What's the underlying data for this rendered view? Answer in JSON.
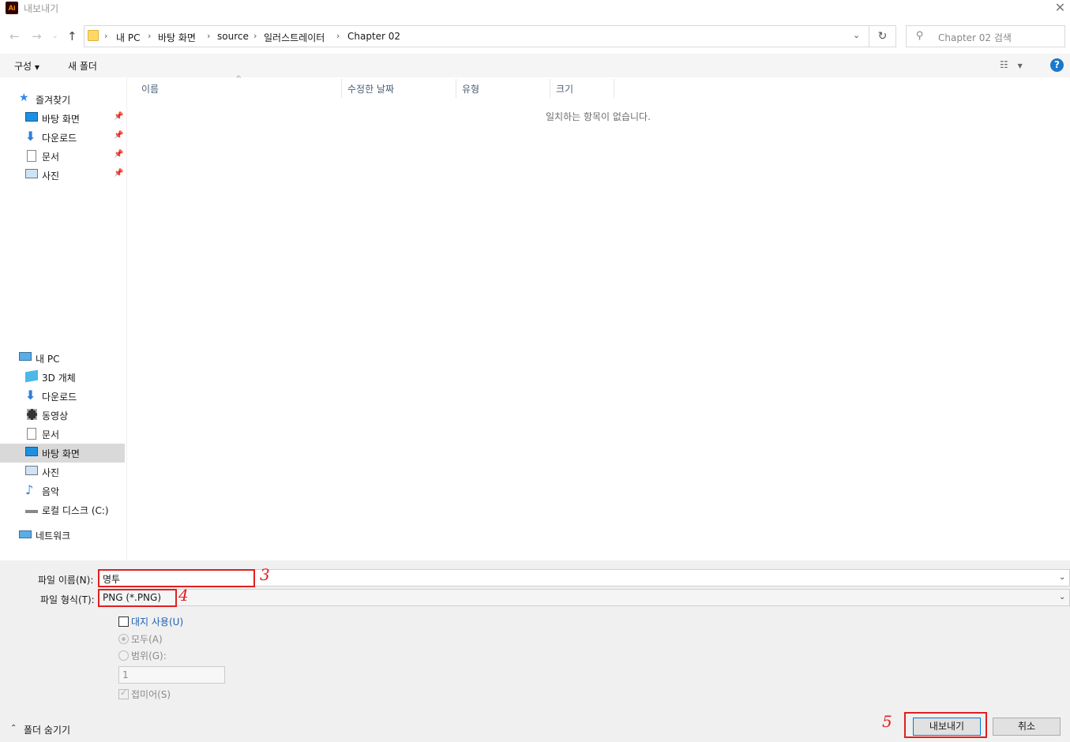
{
  "window": {
    "title": "내보내기",
    "app_icon": "Ai"
  },
  "nav": {
    "breadcrumb": [
      "내 PC",
      "바탕 화면",
      "source",
      "일러스트레이터",
      "Chapter 02"
    ],
    "search_placeholder": "Chapter 02 검색"
  },
  "toolbar": {
    "organize": "구성",
    "new_folder": "새 폴더"
  },
  "sidebar": {
    "favorites": {
      "label": "즐겨찾기",
      "items": [
        "바탕 화면",
        "다운로드",
        "문서",
        "사진"
      ]
    },
    "pc": {
      "label": "내 PC",
      "items": [
        "3D 개체",
        "다운로드",
        "동영상",
        "문서",
        "바탕 화면",
        "사진",
        "음악",
        "로컬 디스크 (C:)"
      ],
      "selected": "바탕 화면"
    },
    "network": {
      "label": "네트워크"
    }
  },
  "columns": [
    "이름",
    "수정한 날짜",
    "유형",
    "크기"
  ],
  "empty_message": "일치하는 항목이 없습니다.",
  "form": {
    "filename_label": "파일 이름(N):",
    "filename_value": "명투",
    "filetype_label": "파일 형식(T):",
    "filetype_value": "PNG (*.PNG)",
    "use_artboards": "대지 사용(U)",
    "all": "모두(A)",
    "range": "범위(G):",
    "range_value": "1",
    "anti_alias": "접미어(S)"
  },
  "annotations": [
    "3",
    "4",
    "5"
  ],
  "footer": {
    "hide_folders": "폴더 숨기기",
    "export_button": "내보내기",
    "cancel_button": "취소"
  },
  "colors": {
    "accent": "#1979ca",
    "annotation_red": "#e02020",
    "selected_bg": "#d9d9d9"
  }
}
